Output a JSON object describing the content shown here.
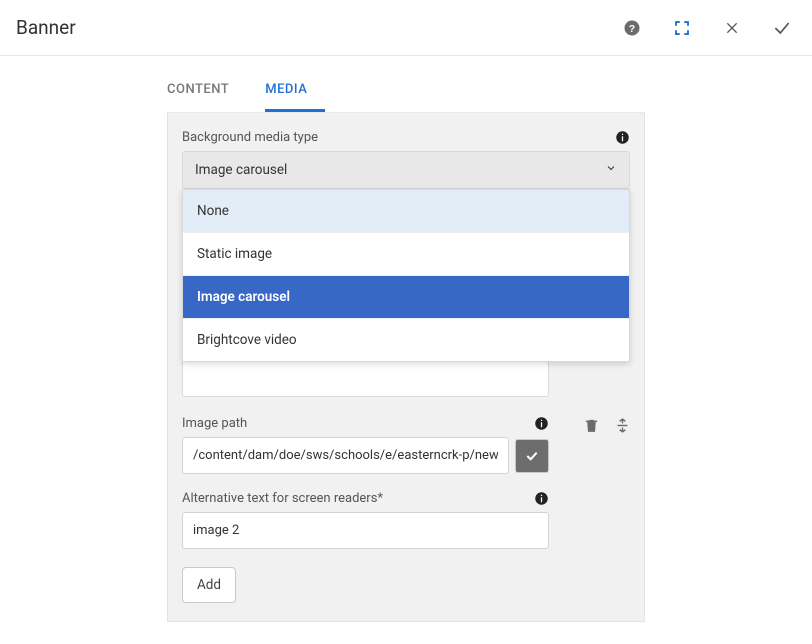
{
  "header": {
    "title": "Banner"
  },
  "tabs": {
    "content": "CONTENT",
    "media": "MEDIA"
  },
  "bgMedia": {
    "label": "Background media type",
    "selected": "Image carousel",
    "options": {
      "none": "None",
      "static": "Static image",
      "carousel": "Image carousel",
      "brightcove": "Brightcove video"
    }
  },
  "imagePath": {
    "label": "Image path",
    "value": "/content/dam/doe/sws/schools/e/easterncrk-p/news/BASC"
  },
  "altText": {
    "label": "Alternative text for screen readers*",
    "value": "image 2"
  },
  "addButton": "Add"
}
